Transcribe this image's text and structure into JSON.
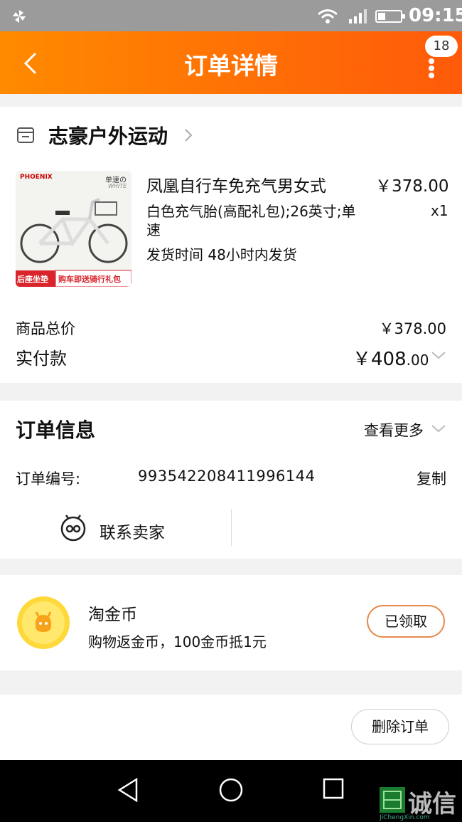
{
  "status_bar": {
    "time": "09:15"
  },
  "header": {
    "title": "订单详情",
    "badge_count": "18"
  },
  "shop": {
    "name": "志豪户外运动"
  },
  "item": {
    "name": "凤凰自行车免充气男女式",
    "price": "￥378.00",
    "sku": "白色充气胎(高配礼包);26英寸;单速",
    "quantity": "x1",
    "shipping": "发货时间 48小时内发货",
    "thumb_brand": "PHOENIX",
    "thumb_tag": "单速の",
    "thumb_tag2": "WHITE",
    "thumb_left_banner": "后座坐垫",
    "thumb_right_banner": "购车即送骑行礼包"
  },
  "summary": {
    "total_label": "商品总价",
    "total_value": "￥378.00",
    "paid_label": "实付款",
    "paid_symbol": "￥",
    "paid_int": "408",
    "paid_cents": ".00"
  },
  "order_info": {
    "heading": "订单信息",
    "more": "查看更多",
    "number_label": "订单编号:",
    "number_value": "993542208411996144",
    "copy_label": "复制",
    "contact_label": "联系卖家"
  },
  "coins": {
    "title": "淘金币",
    "desc": "购物返金币，100金币抵1元",
    "button": "已领取"
  },
  "footer": {
    "delete_button": "删除订单"
  },
  "watermark": {
    "text": "诚信",
    "sub": "JiChengXin.com"
  },
  "colors": {
    "header_start": "#ff8a00",
    "header_end": "#ff5a0a",
    "coin_button_border": "#e88a4a"
  }
}
